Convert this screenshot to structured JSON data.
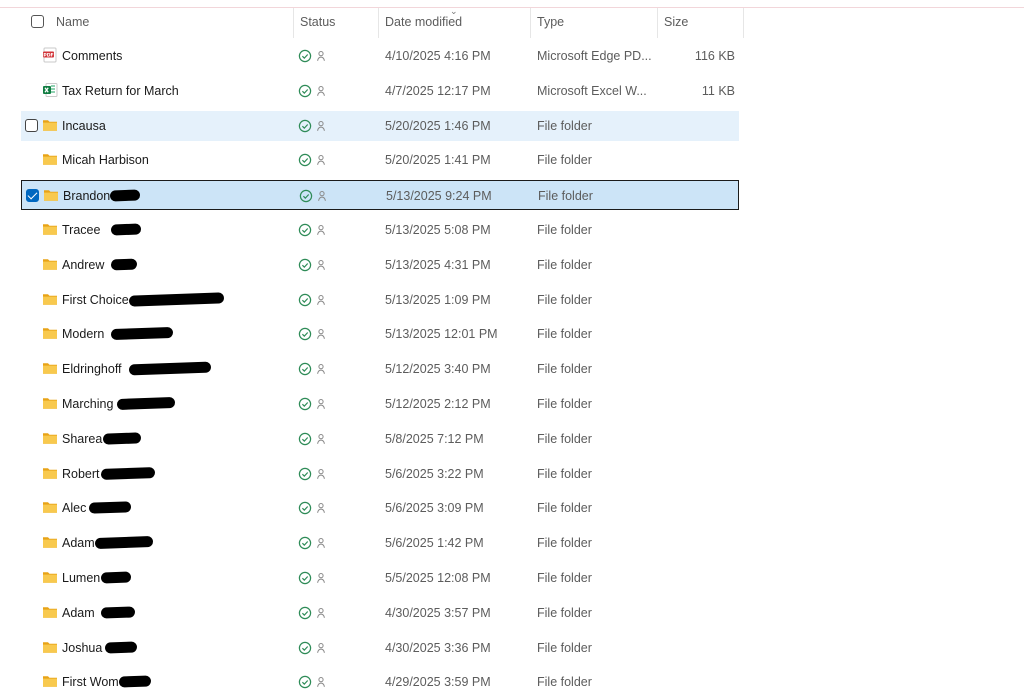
{
  "columns": {
    "name": "Name",
    "status": "Status",
    "date_modified": "Date modified",
    "type": "Type",
    "size": "Size"
  },
  "colors": {
    "folder": "#f5c542",
    "selected_bg": "#cce4f7",
    "hover_bg": "#e5f1fb",
    "sync_green": "#2e8b57",
    "accent": "#0067c0"
  },
  "files": [
    {
      "name": "Comments",
      "icon": "pdf-icon",
      "date": "4/10/2025 4:16 PM",
      "type": "Microsoft Edge PD...",
      "size": "116 KB"
    },
    {
      "name": "Tax Return for March",
      "icon": "excel-icon",
      "date": "4/7/2025 12:17 PM",
      "type": "Microsoft Excel W...",
      "size": "11 KB"
    },
    {
      "name": "Incausa",
      "icon": "folder-icon",
      "date": "5/20/2025 1:46 PM",
      "type": "File folder",
      "size": "",
      "state": "hover"
    },
    {
      "name": "Micah Harbison",
      "icon": "folder-icon",
      "date": "5/20/2025 1:41 PM",
      "type": "File folder",
      "size": ""
    },
    {
      "name": "Brandon",
      "icon": "folder-icon",
      "date": "5/13/2025 9:24 PM",
      "type": "File folder",
      "size": "",
      "state": "selected"
    },
    {
      "name": "Tracee",
      "icon": "folder-icon",
      "date": "5/13/2025 5:08 PM",
      "type": "File folder",
      "size": ""
    },
    {
      "name": "Andrew",
      "icon": "folder-icon",
      "date": "5/13/2025 4:31 PM",
      "type": "File folder",
      "size": ""
    },
    {
      "name": "First Choice",
      "icon": "folder-icon",
      "date": "5/13/2025 1:09 PM",
      "type": "File folder",
      "size": ""
    },
    {
      "name": "Modern",
      "icon": "folder-icon",
      "date": "5/13/2025 12:01 PM",
      "type": "File folder",
      "size": ""
    },
    {
      "name": "Eldringhoff",
      "icon": "folder-icon",
      "date": "5/12/2025 3:40 PM",
      "type": "File folder",
      "size": ""
    },
    {
      "name": "Marching",
      "icon": "folder-icon",
      "date": "5/12/2025 2:12 PM",
      "type": "File folder",
      "size": ""
    },
    {
      "name": "Sharea",
      "icon": "folder-icon",
      "date": "5/8/2025 7:12 PM",
      "type": "File folder",
      "size": ""
    },
    {
      "name": "Robert",
      "icon": "folder-icon",
      "date": "5/6/2025 3:22 PM",
      "type": "File folder",
      "size": ""
    },
    {
      "name": "Alec",
      "icon": "folder-icon",
      "date": "5/6/2025 3:09 PM",
      "type": "File folder",
      "size": ""
    },
    {
      "name": "Adam",
      "icon": "folder-icon",
      "date": "5/6/2025 1:42 PM",
      "type": "File folder",
      "size": ""
    },
    {
      "name": "Lumen",
      "icon": "folder-icon",
      "date": "5/5/2025 12:08 PM",
      "type": "File folder",
      "size": ""
    },
    {
      "name": "Adam",
      "icon": "folder-icon",
      "date": "4/30/2025 3:57 PM",
      "type": "File folder",
      "size": ""
    },
    {
      "name": "Joshua",
      "icon": "folder-icon",
      "date": "4/30/2025 3:36 PM",
      "type": "File folder",
      "size": ""
    },
    {
      "name": "First Women",
      "icon": "folder-icon",
      "date": "4/29/2025 3:59 PM",
      "type": "File folder",
      "size": ""
    }
  ]
}
